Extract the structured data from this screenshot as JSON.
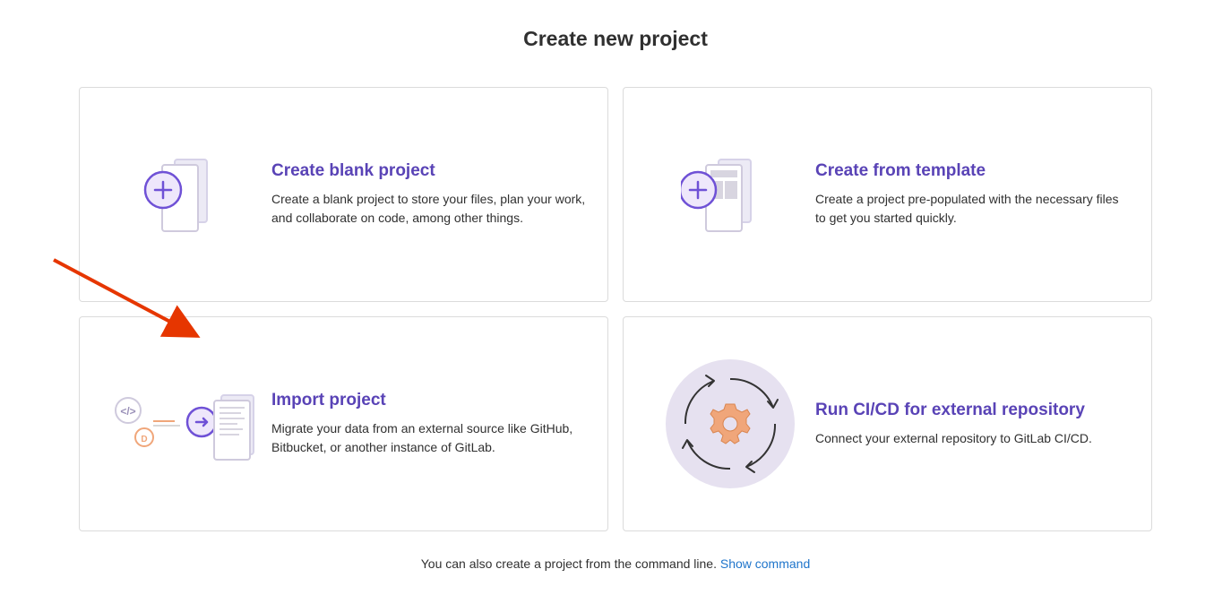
{
  "page": {
    "title": "Create new project"
  },
  "cards": {
    "blank": {
      "title": "Create blank project",
      "desc": "Create a blank project to store your files, plan your work, and collaborate on code, among other things."
    },
    "template": {
      "title": "Create from template",
      "desc": "Create a project pre-populated with the necessary files to get you started quickly."
    },
    "import": {
      "title": "Import project",
      "desc": "Migrate your data from an external source like GitHub, Bitbucket, or another instance of GitLab."
    },
    "cicd": {
      "title": "Run CI/CD for external repository",
      "desc": "Connect your external repository to GitLab CI/CD."
    }
  },
  "footer": {
    "text": "You can also create a project from the command line. ",
    "link": "Show command"
  }
}
